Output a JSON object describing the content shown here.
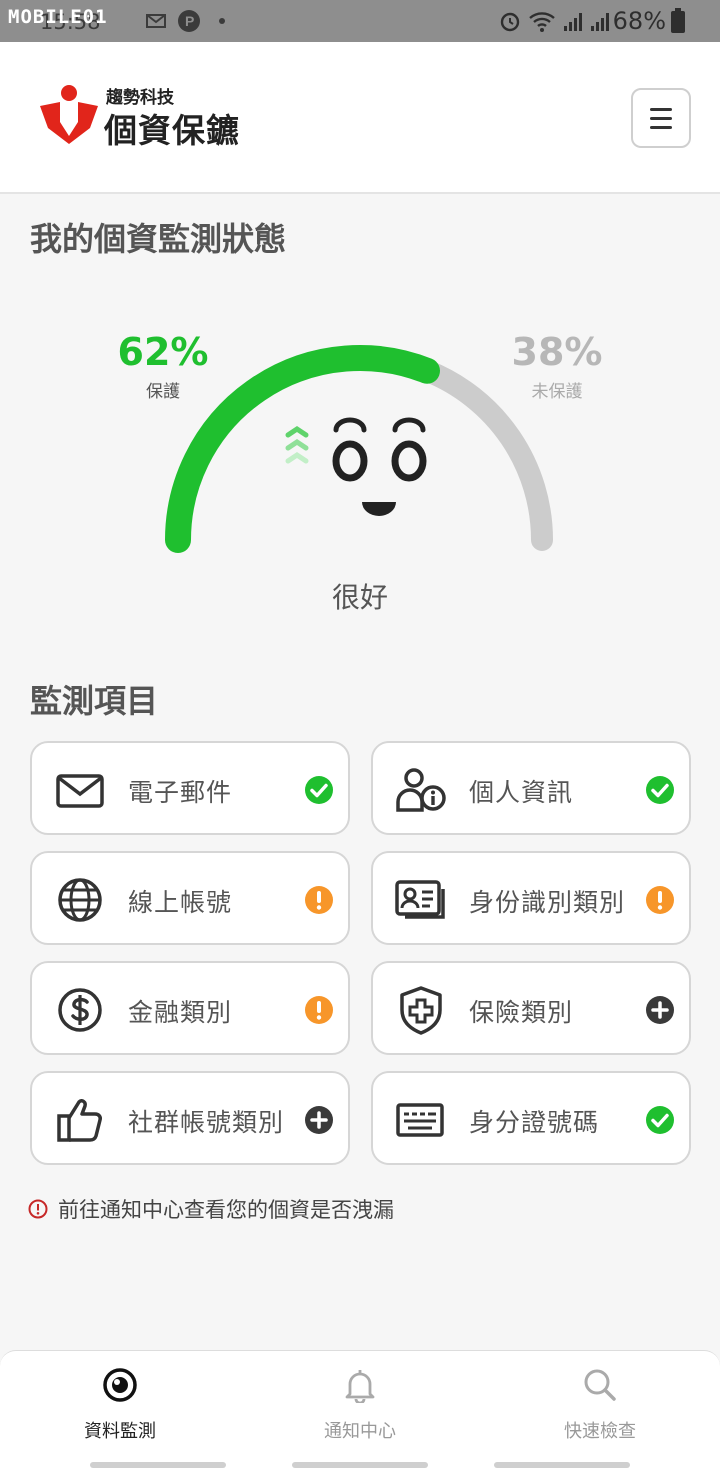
{
  "status_bar": {
    "watermark": "MOBILE01",
    "clock": "15:58",
    "battery": "68%"
  },
  "header": {
    "brand_sub": "趨勢科技",
    "brand_main": "個資保鑣",
    "menu_icon": "hamburger-menu-icon"
  },
  "monitor": {
    "title": "我的個資監測狀態",
    "protected_percent": "62%",
    "protected_label": "保護",
    "unprotected_percent": "38%",
    "unprotected_label": "未保護",
    "protected_fraction": 0.62,
    "status_text": "很好",
    "colors": {
      "protected": "#1fbf2f",
      "unprotected": "#cccccc"
    }
  },
  "items": {
    "title": "監測項目",
    "cards": [
      {
        "label": "電子郵件",
        "icon": "envelope-icon",
        "status": "ok"
      },
      {
        "label": "個人資訊",
        "icon": "person-info-icon",
        "status": "ok"
      },
      {
        "label": "線上帳號",
        "icon": "globe-icon",
        "status": "warning"
      },
      {
        "label": "身份識別類別",
        "icon": "id-card-icon",
        "status": "warning"
      },
      {
        "label": "金融類別",
        "icon": "dollar-icon",
        "status": "warning"
      },
      {
        "label": "保險類別",
        "icon": "shield-plus-icon",
        "status": "add"
      },
      {
        "label": "社群帳號類別",
        "icon": "thumbs-up-icon",
        "status": "add"
      },
      {
        "label": "身分證號碼",
        "icon": "keyboard-icon",
        "status": "ok"
      }
    ]
  },
  "notice": "前往通知中心查看您的個資是否洩漏",
  "bottom_nav": [
    {
      "label": "資料監測",
      "icon": "eye-icon",
      "active": true
    },
    {
      "label": "通知中心",
      "icon": "bell-icon",
      "active": false
    },
    {
      "label": "快速檢查",
      "icon": "search-icon",
      "active": false
    }
  ]
}
